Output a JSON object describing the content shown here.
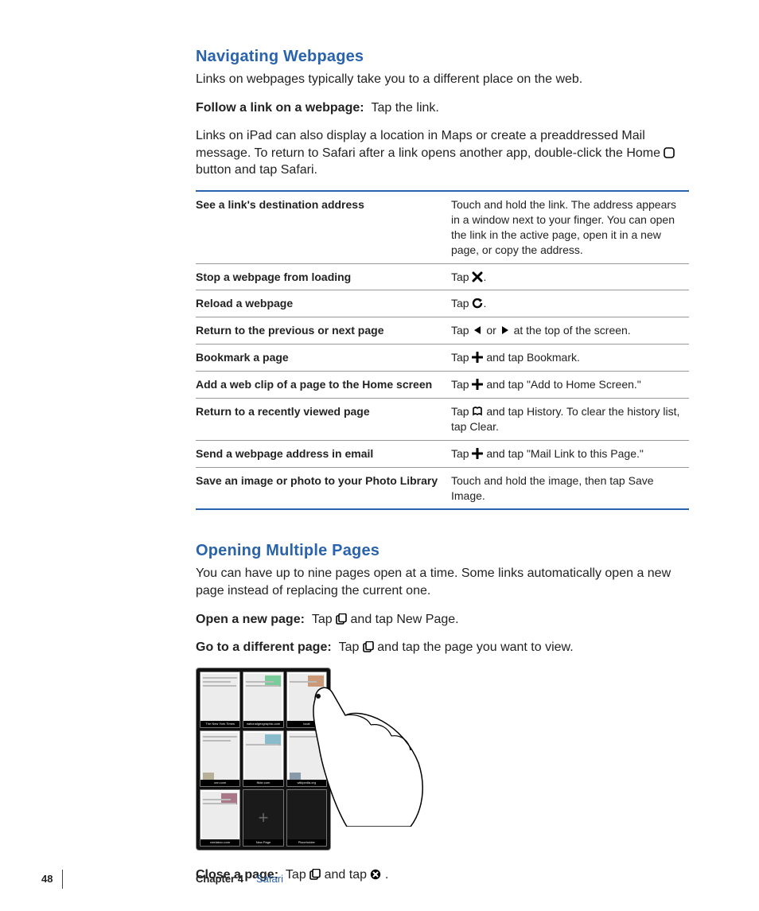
{
  "section1": {
    "heading": "Navigating Webpages",
    "intro": "Links on webpages typically take you to a different place on the web.",
    "followLabel": "Follow a link on a webpage:",
    "followText": "Tap the link.",
    "para2a": "Links on iPad can also display a location in Maps or create a preaddressed Mail message. To return to Safari after a link opens another app, double-click the Home ",
    "para2b": " button and tap Safari."
  },
  "table": [
    {
      "l": "See a link's destination address",
      "r": "Touch and hold the link. The address appears in a window next to your finger. You can open the link in the active page, open it in a new page, or copy the address."
    },
    {
      "l": "Stop a webpage from loading",
      "r_pre": "Tap ",
      "icon": "x",
      "r_post": "."
    },
    {
      "l": "Reload a webpage",
      "r_pre": "Tap ",
      "icon": "reload",
      "r_post": "."
    },
    {
      "l": "Return to the previous or next page",
      "r_pre": "Tap ",
      "icon": "back",
      "r_mid": " or ",
      "icon2": "fwd",
      "r_post": " at the top of the screen."
    },
    {
      "l": "Bookmark a page",
      "r_pre": "Tap ",
      "icon": "plus",
      "r_post": " and tap Bookmark."
    },
    {
      "l": "Add a web clip of a page to the Home screen",
      "r_pre": "Tap ",
      "icon": "plus",
      "r_post": " and tap \"Add to Home Screen.\""
    },
    {
      "l": "Return to a recently viewed page",
      "r_pre": "Tap ",
      "icon": "book",
      "r_post": " and tap History. To clear the history list, tap Clear."
    },
    {
      "l": "Send a webpage address in email",
      "r_pre": "Tap ",
      "icon": "plus",
      "r_post": " and tap \"Mail Link to this Page.\""
    },
    {
      "l": "Save an image or photo to your Photo Library",
      "r": "Touch and hold the image, then tap Save Image."
    }
  ],
  "section2": {
    "heading": "Opening Multiple Pages",
    "intro": "You can have up to nine pages open at a time. Some links automatically open a new page instead of replacing the current one.",
    "openLabel": "Open a new page:",
    "openText_a": "Tap ",
    "openText_b": " and tap New Page.",
    "gotoLabel": "Go to a different page:",
    "gotoText_a": "Tap ",
    "gotoText_b": " and tap the page you want to view.",
    "closeLabel": "Close a page:",
    "closeText_a": "Tap ",
    "closeText_b": " and tap ",
    "closeText_c": "."
  },
  "thumbs": [
    "The New York Times",
    "nationalgeographic.com",
    "local",
    "cnn.com",
    "flickr.com",
    "wikipedia.org",
    "neelaboo.com",
    "New Page",
    "Placeholder"
  ],
  "footer": {
    "page": "48",
    "chapter": "Chapter 4",
    "name": "Safari"
  }
}
